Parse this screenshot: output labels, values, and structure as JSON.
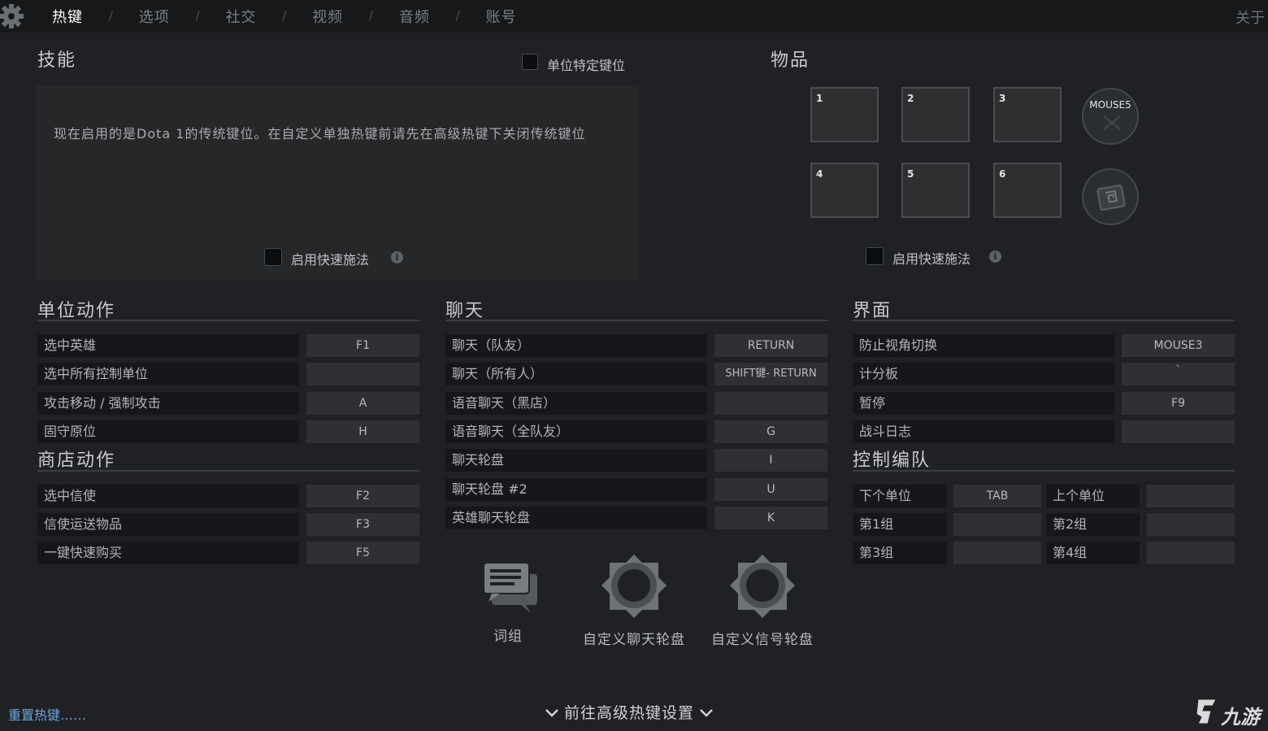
{
  "topbar": {
    "tabs": [
      "热键",
      "选项",
      "社交",
      "视频",
      "音频",
      "账号"
    ],
    "separator": "/",
    "about": "关于"
  },
  "skills": {
    "title": "技能",
    "unit_specific_label": "单位特定键位",
    "notice": "现在启用的是Dota 1的传统键位。在自定义单独热键前请先在高级热键下关闭传统键位",
    "quickcast_label": "启用快速施法"
  },
  "items": {
    "title": "物品",
    "slots": [
      "1",
      "2",
      "3",
      "4",
      "5",
      "6"
    ],
    "special_slot_label": "MOUSE5",
    "quickcast_label": "启用快速施法"
  },
  "unit_actions": {
    "title": "单位动作",
    "rows": [
      {
        "label": "选中英雄",
        "key": "F1"
      },
      {
        "label": "选中所有控制单位",
        "key": ""
      },
      {
        "label": "攻击移动 / 强制攻击",
        "key": "A"
      },
      {
        "label": "固守原位",
        "key": "H"
      }
    ]
  },
  "shop_actions": {
    "title": "商店动作",
    "rows": [
      {
        "label": "选中信使",
        "key": "F2"
      },
      {
        "label": "信使运送物品",
        "key": "F3"
      },
      {
        "label": "一键快速购买",
        "key": "F5"
      }
    ]
  },
  "chat": {
    "title": "聊天",
    "rows": [
      {
        "label": "聊天（队友）",
        "key": "RETURN"
      },
      {
        "label": "聊天（所有人）",
        "key": "SHIFT键- RETURN"
      },
      {
        "label": "语音聊天（黑店）",
        "key": ""
      },
      {
        "label": "语音聊天（全队友）",
        "key": "G"
      },
      {
        "label": "聊天轮盘",
        "key": "I"
      },
      {
        "label": "聊天轮盘 #2",
        "key": "U"
      },
      {
        "label": "英雄聊天轮盘",
        "key": "K"
      }
    ],
    "buttons": [
      "词组",
      "自定义聊天轮盘",
      "自定义信号轮盘"
    ]
  },
  "interface": {
    "title": "界面",
    "rows": [
      {
        "label": "防止视角切换",
        "key": "MOUSE3"
      },
      {
        "label": "计分板",
        "key": "`"
      },
      {
        "label": "暂停",
        "key": "F9"
      },
      {
        "label": "战斗日志",
        "key": ""
      }
    ]
  },
  "control_groups": {
    "title": "控制编队",
    "rows": [
      {
        "left_label": "下个单位",
        "left_key": "TAB",
        "right_label": "上个单位",
        "right_key": ""
      },
      {
        "left_label": "第1组",
        "left_key": "",
        "right_label": "第2组",
        "right_key": ""
      },
      {
        "left_label": "第3组",
        "left_key": "",
        "right_label": "第4组",
        "right_key": ""
      }
    ]
  },
  "footer": {
    "reset": "重置热键……",
    "advanced": "前往高级热键设置",
    "watermark": "九游"
  },
  "colors": {
    "background": "#1f2124",
    "topbar": "#16181a",
    "row_label_bg": "#15171a",
    "key_bg": "#2e3034",
    "link": "#6aa7dc",
    "active_tab": "#ffffff"
  },
  "icons": [
    "gear-icon",
    "info-icon",
    "chat-bubbles-icon",
    "chat-wheel-icon",
    "ping-wheel-icon",
    "chevron-down-icon",
    "scroll-icon",
    "jiuyou-logo"
  ]
}
